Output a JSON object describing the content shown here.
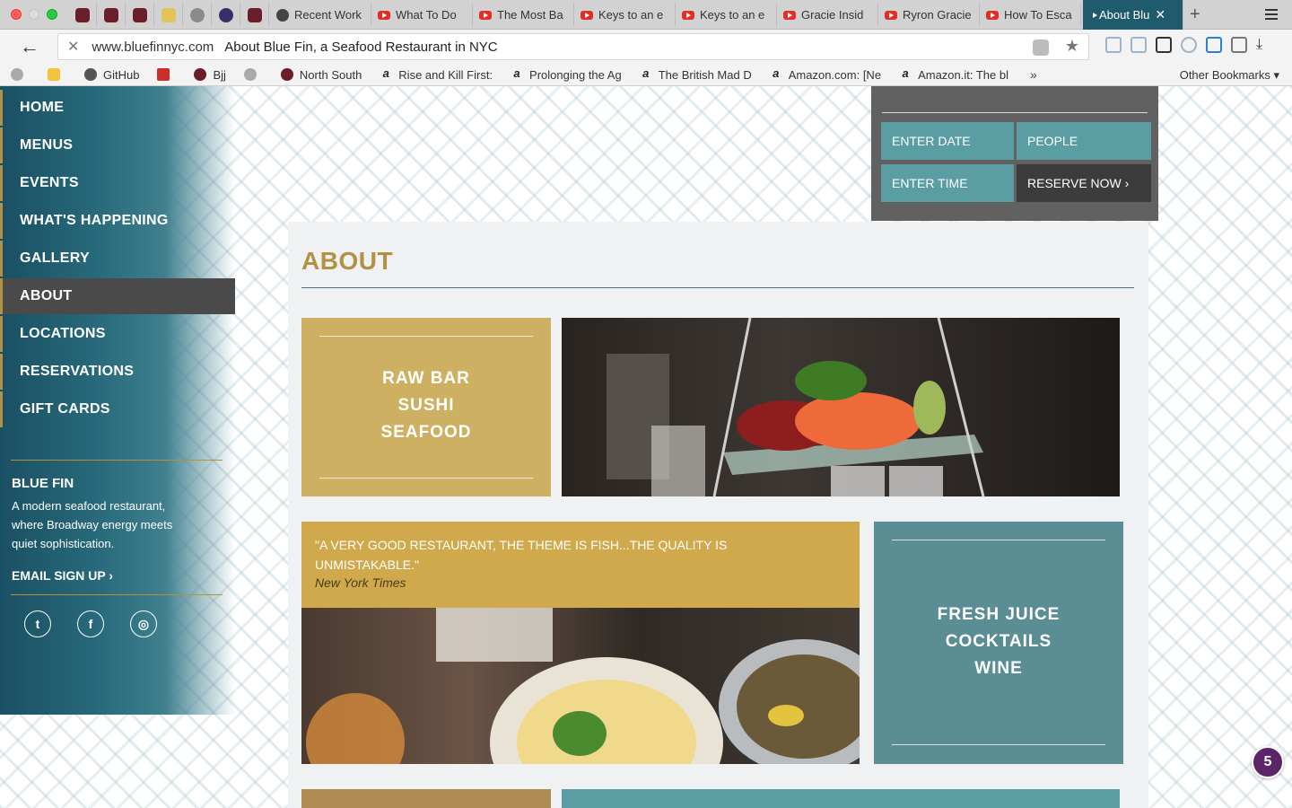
{
  "browser": {
    "tabs": [
      {
        "label": "Recent Work",
        "icon": "github-icon"
      },
      {
        "label": "What To Do",
        "icon": "youtube-icon"
      },
      {
        "label": "The Most Ba",
        "icon": "youtube-icon"
      },
      {
        "label": "Keys to an e",
        "icon": "youtube-icon"
      },
      {
        "label": "Keys to an e",
        "icon": "youtube-icon"
      },
      {
        "label": "Gracie Insid",
        "icon": "youtube-icon"
      },
      {
        "label": "Ryron Gracie",
        "icon": "youtube-icon"
      },
      {
        "label": "How To Esca",
        "icon": "youtube-icon"
      }
    ],
    "active_tab": {
      "label": "About Blu"
    },
    "url_domain": "www.bluefinnyc.com",
    "page_title": "About Blue Fin, a Seafood Restaurant in NYC",
    "bookmarks": [
      {
        "label": "GitHub",
        "icon": "github-icon"
      },
      {
        "label": "",
        "icon": "ll-icon"
      },
      {
        "label": "Bjj",
        "icon": "folder-icon"
      },
      {
        "label": "",
        "icon": "cat-icon"
      },
      {
        "label": "North South",
        "icon": "site-icon"
      },
      {
        "label": "Rise and Kill First:",
        "icon": "amazon-icon"
      },
      {
        "label": "Prolonging the Ag",
        "icon": "amazon-icon"
      },
      {
        "label": "The British Mad D",
        "icon": "amazon-icon"
      },
      {
        "label": "Amazon.com: [Ne",
        "icon": "amazon-icon"
      },
      {
        "label": "Amazon.it: The bl",
        "icon": "amazon-icon"
      }
    ],
    "other_bookmarks": "Other Bookmarks"
  },
  "sidebar": {
    "nav": [
      {
        "label": "HOME"
      },
      {
        "label": "MENUS"
      },
      {
        "label": "EVENTS"
      },
      {
        "label": "WHAT'S HAPPENING"
      },
      {
        "label": "GALLERY"
      },
      {
        "label": "ABOUT"
      },
      {
        "label": "LOCATIONS"
      },
      {
        "label": "RESERVATIONS"
      },
      {
        "label": "GIFT CARDS"
      }
    ],
    "active_nav": "ABOUT",
    "brand": "BLUE FIN",
    "description": "A modern seafood restaurant, where Broadway energy meets quiet sophistication.",
    "email_signup": "EMAIL SIGN UP",
    "social": [
      "twitter-icon",
      "facebook-icon",
      "instagram-icon"
    ]
  },
  "reservation": {
    "enter_date": "ENTER DATE",
    "people": "PEOPLE",
    "enter_time": "ENTER TIME",
    "reserve_now": "RESERVE NOW"
  },
  "about": {
    "title": "ABOUT",
    "tile1": [
      "RAW BAR",
      "SUSHI",
      "SEAFOOD"
    ],
    "quote": "\"A VERY GOOD RESTAURANT, THE THEME IS FISH...THE QUALITY IS UNMISTAKABLE.\"",
    "quote_source": "New York Times",
    "tile2": [
      "FRESH JUICE",
      "COCKTAILS",
      "WINE"
    ]
  },
  "chat_badge": "5",
  "colors": {
    "gold": "#b19245",
    "teal": "#5a9ea4",
    "sidebar": "#1a5063"
  }
}
